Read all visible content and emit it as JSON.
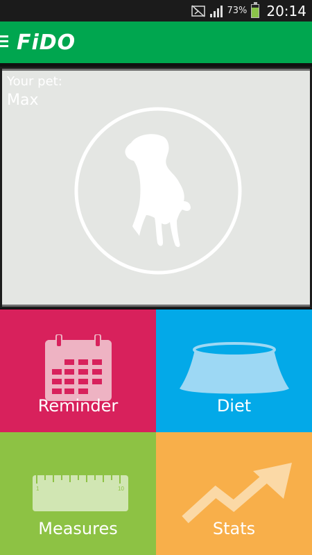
{
  "status_bar": {
    "battery_percent": "73%",
    "time": "20:14",
    "icons": [
      "mute-icon",
      "signal-icon",
      "battery-icon"
    ]
  },
  "app_bar": {
    "title": "FiDO",
    "menu_icon": "menu-icon"
  },
  "pet": {
    "caption": "Your pet:",
    "name": "Max",
    "avatar_icon": "dog-silhouette-icon"
  },
  "tiles": [
    {
      "label": "Reminder",
      "icon": "calendar-icon",
      "color": "#d8215c"
    },
    {
      "label": "Diet",
      "icon": "bowl-icon",
      "color": "#03a9e8"
    },
    {
      "label": "Measures",
      "icon": "ruler-icon",
      "color": "#8dc244",
      "ruler_marks": [
        "1",
        "10"
      ]
    },
    {
      "label": "Stats",
      "icon": "trend-up-icon",
      "color": "#f8af4a"
    }
  ],
  "colors": {
    "app_bar": "#00a64f",
    "pet_card": "#e4e6e3"
  }
}
